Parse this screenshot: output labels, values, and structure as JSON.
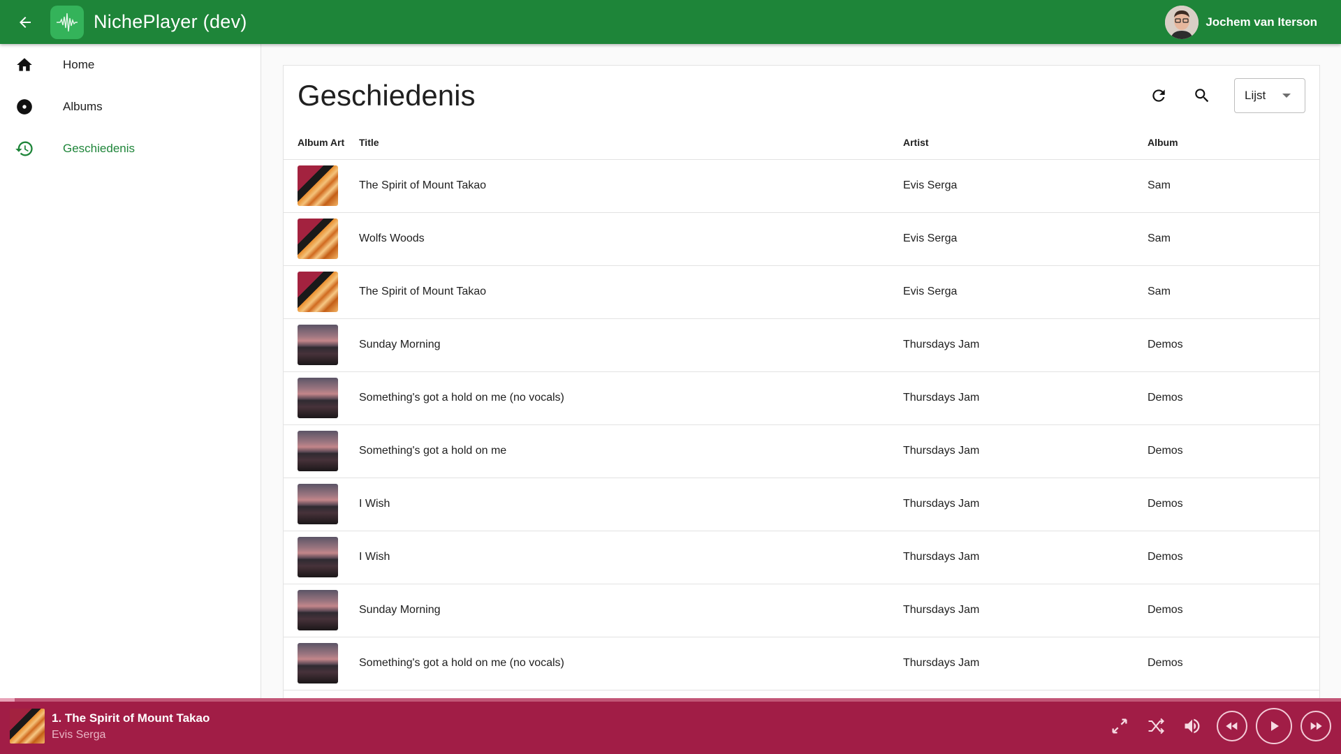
{
  "app": {
    "title": "NichePlayer (dev)",
    "user_name": "Jochem van Iterson",
    "brand_color": "#1e8539",
    "player_color": "#a11d46"
  },
  "sidebar": {
    "items": [
      {
        "label": "Home",
        "icon": "home-icon",
        "active": false
      },
      {
        "label": "Albums",
        "icon": "album-icon",
        "active": false
      },
      {
        "label": "Geschiedenis",
        "icon": "history-icon",
        "active": true
      }
    ]
  },
  "main": {
    "title": "Geschiedenis",
    "view_select": "Lijst",
    "columns": [
      "Album Art",
      "Title",
      "Artist",
      "Album"
    ],
    "rows": [
      {
        "art": "sam",
        "title": "The Spirit of Mount Takao",
        "artist": "Evis Serga",
        "album": "Sam"
      },
      {
        "art": "sam",
        "title": "Wolfs Woods",
        "artist": "Evis Serga",
        "album": "Sam"
      },
      {
        "art": "sam",
        "title": "The Spirit of Mount Takao",
        "artist": "Evis Serga",
        "album": "Sam"
      },
      {
        "art": "demos",
        "title": "Sunday Morning",
        "artist": "Thursdays Jam",
        "album": "Demos"
      },
      {
        "art": "demos",
        "title": "Something's got a hold on me (no vocals)",
        "artist": "Thursdays Jam",
        "album": "Demos"
      },
      {
        "art": "demos",
        "title": "Something's got a hold on me",
        "artist": "Thursdays Jam",
        "album": "Demos"
      },
      {
        "art": "demos",
        "title": "I Wish",
        "artist": "Thursdays Jam",
        "album": "Demos"
      },
      {
        "art": "demos",
        "title": "I Wish",
        "artist": "Thursdays Jam",
        "album": "Demos"
      },
      {
        "art": "demos",
        "title": "Sunday Morning",
        "artist": "Thursdays Jam",
        "album": "Demos"
      },
      {
        "art": "demos",
        "title": "Something's got a hold on me (no vocals)",
        "artist": "Thursdays Jam",
        "album": "Demos"
      }
    ]
  },
  "player": {
    "track_title": "1. The Spirit of Mount Takao",
    "track_artist": "Evis Serga",
    "progress_fraction": 0.011
  }
}
